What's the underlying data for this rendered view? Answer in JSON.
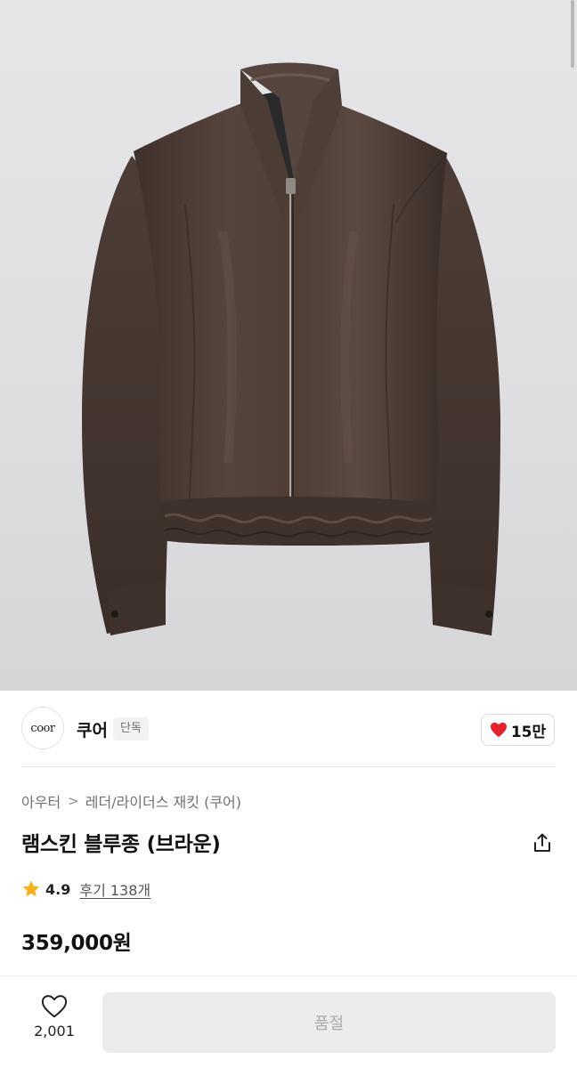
{
  "product_image": {
    "subject": "jacket-image",
    "colors": {
      "background": "#dededf",
      "leather": "#4a3a33",
      "leather_highlight": "#6a5850",
      "leather_shadow": "#2e2420",
      "lining": "#2a2a2c"
    }
  },
  "brand": {
    "logo_text": "coor",
    "name": "쿠어",
    "tag": "단독",
    "likes": "15만",
    "like_icon": "heart-icon",
    "like_color": "#e5212b"
  },
  "product": {
    "breadcrumb": [
      "아우터",
      "레더/라이더스 재킷 (쿠어)"
    ],
    "breadcrumb_separator": ">",
    "title": "램스킨 블루종 (브라운)",
    "share_icon": "share-icon",
    "rating": {
      "icon": "star-icon",
      "star_color": "#f6b01e",
      "score": "4.9",
      "reviews": "후기 138개"
    },
    "price": "359,000원"
  },
  "bottom_bar": {
    "wish_icon": "heart-outline-icon",
    "wish_count": "2,001",
    "action_label": "품절"
  }
}
